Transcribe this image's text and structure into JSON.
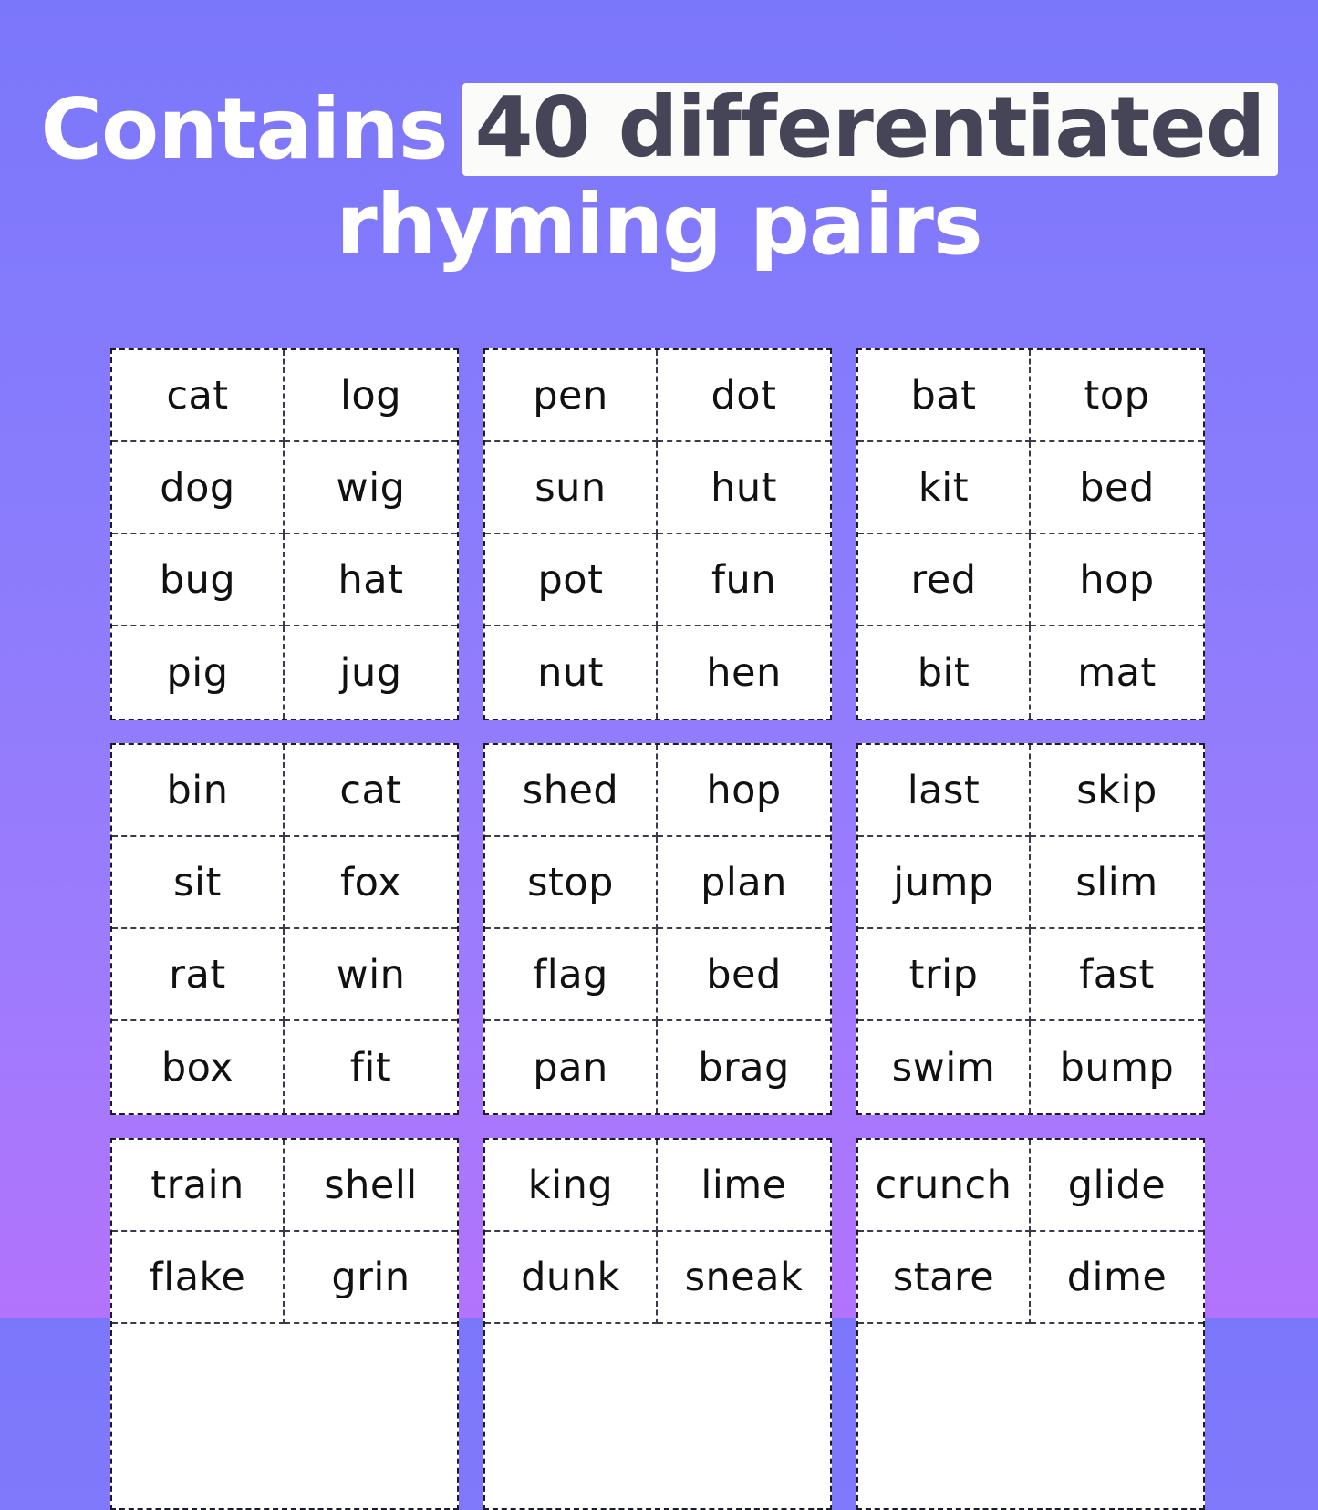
{
  "heading": {
    "line1_plain": "Contains",
    "line1_highlight": "40 differentiated",
    "line2": "rhyming pairs"
  },
  "colors": {
    "background_top": "#7b77fb",
    "background_bottom": "#b373fc",
    "highlight_background": "#fbfbfa",
    "highlight_text": "#454557",
    "heading_text": "#ffffff",
    "card_background": "#ffffff",
    "card_border": "#1b1b2b",
    "card_divider": "#3a3a4a",
    "word_text": "#111111"
  },
  "cards": [
    {
      "id": "card-1",
      "rows": [
        [
          "cat",
          "log"
        ],
        [
          "dog",
          "wig"
        ],
        [
          "bug",
          "hat"
        ],
        [
          "pig",
          "jug"
        ]
      ]
    },
    {
      "id": "card-2",
      "rows": [
        [
          "pen",
          "dot"
        ],
        [
          "sun",
          "hut"
        ],
        [
          "pot",
          "fun"
        ],
        [
          "nut",
          "hen"
        ]
      ]
    },
    {
      "id": "card-3",
      "rows": [
        [
          "bat",
          "top"
        ],
        [
          "kit",
          "bed"
        ],
        [
          "red",
          "hop"
        ],
        [
          "bit",
          "mat"
        ]
      ]
    },
    {
      "id": "card-4",
      "rows": [
        [
          "bin",
          "cat"
        ],
        [
          "sit",
          "fox"
        ],
        [
          "rat",
          "win"
        ],
        [
          "box",
          "fit"
        ]
      ]
    },
    {
      "id": "card-5",
      "rows": [
        [
          "shed",
          "hop"
        ],
        [
          "stop",
          "plan"
        ],
        [
          "flag",
          "bed"
        ],
        [
          "pan",
          "brag"
        ]
      ]
    },
    {
      "id": "card-6",
      "rows": [
        [
          "last",
          "skip"
        ],
        [
          "jump",
          "slim"
        ],
        [
          "trip",
          "fast"
        ],
        [
          "swim",
          "bump"
        ]
      ]
    },
    {
      "id": "card-7",
      "rows": [
        [
          "train",
          "shell"
        ],
        [
          "flake",
          "grin"
        ]
      ]
    },
    {
      "id": "card-8",
      "rows": [
        [
          "king",
          "lime"
        ],
        [
          "dunk",
          "sneak"
        ]
      ]
    },
    {
      "id": "card-9",
      "rows": [
        [
          "crunch",
          "glide"
        ],
        [
          "stare",
          "dime"
        ]
      ]
    }
  ]
}
